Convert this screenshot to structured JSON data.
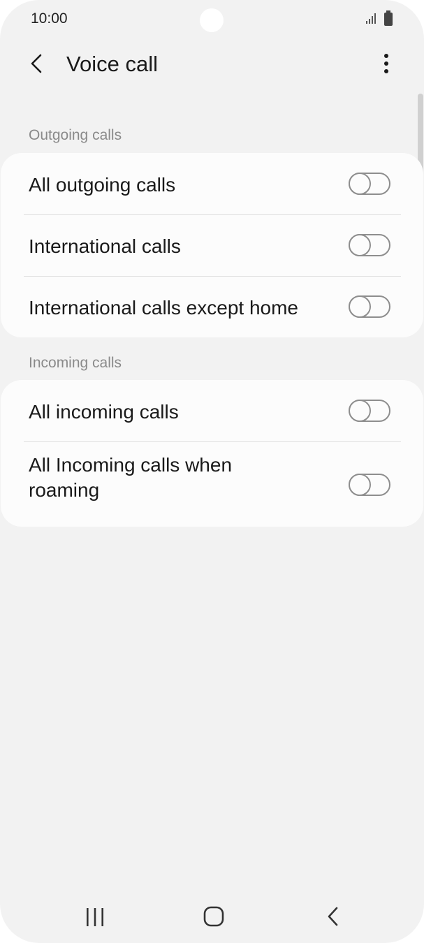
{
  "status_bar": {
    "time": "10:00"
  },
  "header": {
    "title": "Voice call"
  },
  "sections": [
    {
      "header": "Outgoing calls",
      "items": [
        {
          "label": "All outgoing calls",
          "enabled": false
        },
        {
          "label": "International calls",
          "enabled": false
        },
        {
          "label": "International calls except home",
          "enabled": false
        }
      ]
    },
    {
      "header": "Incoming calls",
      "items": [
        {
          "label": "All incoming calls",
          "enabled": false
        },
        {
          "label": "All Incoming calls when roaming",
          "enabled": false
        }
      ]
    }
  ],
  "icons": {
    "back": "back-arrow-icon",
    "more": "more-options-icon",
    "signal": "signal-icon",
    "battery": "battery-icon",
    "nav_recent": "recent-apps-icon",
    "nav_home": "home-icon",
    "nav_back": "nav-back-icon"
  }
}
